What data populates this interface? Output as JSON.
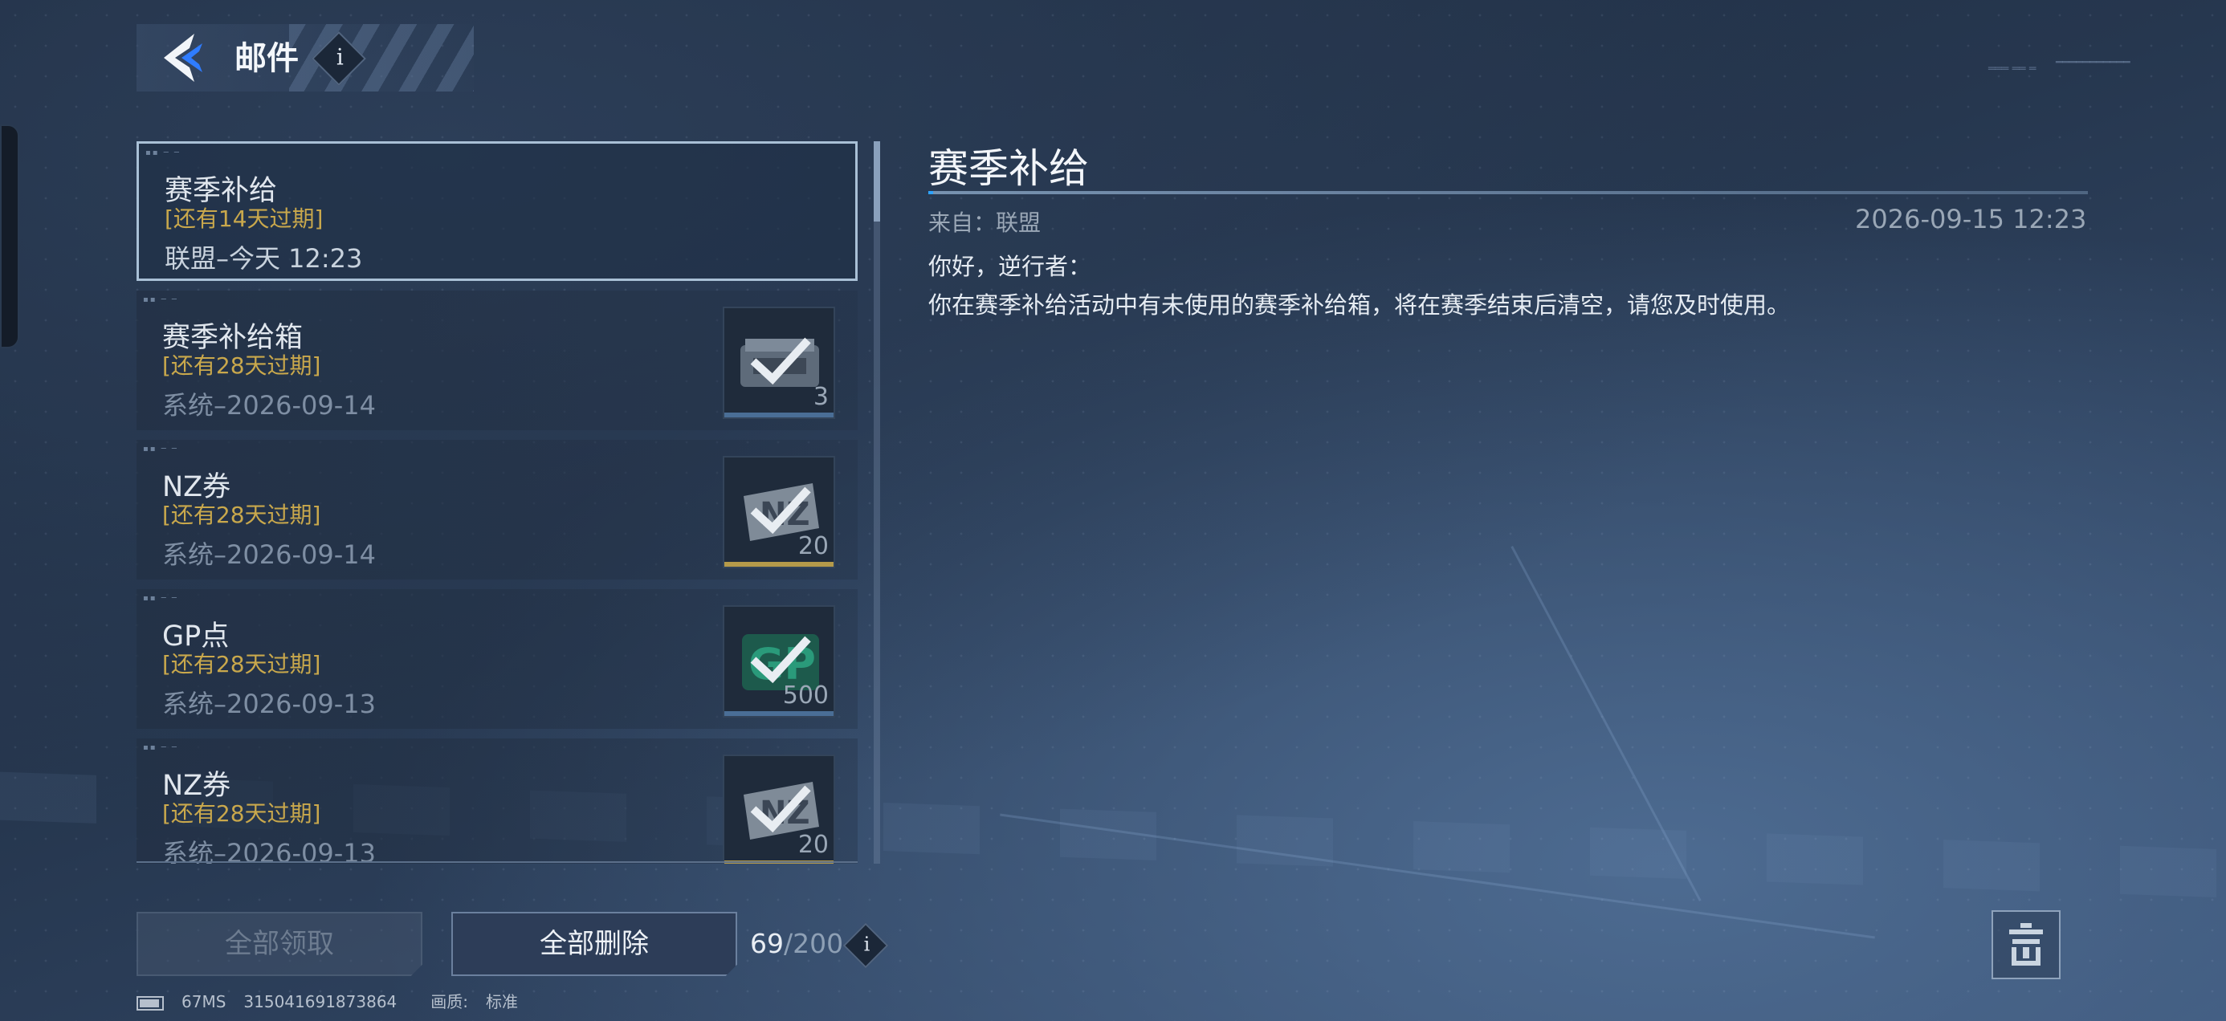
{
  "header": {
    "title": "邮件",
    "info_icon": "i"
  },
  "mail_list": [
    {
      "title": "赛季补给",
      "expire": "[还有14天过期]",
      "meta": "联盟–今天 12:23",
      "selected": true
    },
    {
      "title": "赛季补给箱",
      "expire": "[还有28天过期]",
      "meta": "系统–2026-09-14",
      "attachment": {
        "icon": "supply-box-icon",
        "count": "3",
        "claimed": true
      }
    },
    {
      "title": "NZ券",
      "expire": "[还有28天过期]",
      "meta": "系统–2026-09-14",
      "attachment": {
        "icon": "nz-ticket-icon",
        "count": "20",
        "claimed": true
      }
    },
    {
      "title": "GP点",
      "expire": "[还有28天过期]",
      "meta": "系统–2026-09-13",
      "attachment": {
        "icon": "gp-point-icon",
        "count": "500",
        "claimed": true
      }
    },
    {
      "title": "NZ券",
      "expire": "[还有28天过期]",
      "meta": "系统–2026-09-13",
      "attachment": {
        "icon": "nz-ticket-icon",
        "count": "20",
        "claimed": true
      }
    }
  ],
  "detail": {
    "title": "赛季补给",
    "from": "来自：联盟",
    "date": "2026-09-15 12:23",
    "body_line1": "你好，逆行者：",
    "body_line2": "你在赛季补给活动中有未使用的赛季补给箱，将在赛季结束后清空，请您及时使用。"
  },
  "footer": {
    "claim_all": "全部领取",
    "delete_all": "全部删除",
    "count_current": "69",
    "count_max": "/200",
    "count_info": "i"
  },
  "status": {
    "ping": "67MS",
    "uid": "315041691873864",
    "quality_label": "画质:",
    "quality_value": "标准"
  },
  "colors": {
    "expire_gold": "#c9a84c",
    "selected_border": "#a9c0d6",
    "gp_green": "#2a9a7a",
    "bar_gold": "#b59a4a",
    "bar_blue": "#4a6e96"
  }
}
